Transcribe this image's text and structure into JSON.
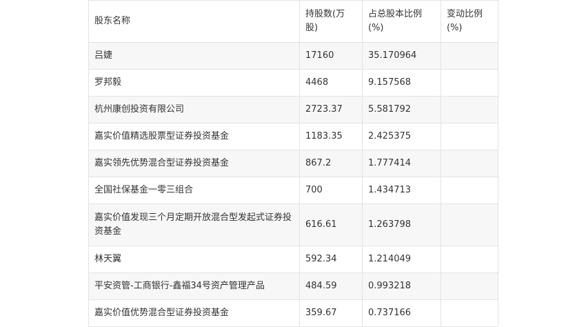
{
  "table": {
    "headers": [
      "股东名称",
      "持股数(万股)",
      "占总股本比例(%)",
      "变动比例(%)"
    ],
    "rows": [
      {
        "name": "吕婕",
        "shares": "17160",
        "ratio": "35.170964",
        "change": ""
      },
      {
        "name": "罗邦毅",
        "shares": "4468",
        "ratio": "9.157568",
        "change": ""
      },
      {
        "name": "杭州康创投资有限公司",
        "shares": "2723.37",
        "ratio": "5.581792",
        "change": ""
      },
      {
        "name": "嘉实价值精选股票型证券投资基金",
        "shares": "1183.35",
        "ratio": "2.425375",
        "change": ""
      },
      {
        "name": "嘉实领先优势混合型证券投资基金",
        "shares": "867.2",
        "ratio": "1.777414",
        "change": ""
      },
      {
        "name": "全国社保基金一零三组合",
        "shares": "700",
        "ratio": "1.434713",
        "change": ""
      },
      {
        "name": "嘉实价值发现三个月定期开放混合型发起式证券投资基金",
        "shares": "616.61",
        "ratio": "1.263798",
        "change": ""
      },
      {
        "name": "林天翼",
        "shares": "592.34",
        "ratio": "1.214049",
        "change": ""
      },
      {
        "name": "平安资管-工商银行-鑫福34号资产管理产品",
        "shares": "484.59",
        "ratio": "0.993218",
        "change": ""
      },
      {
        "name": "嘉实价值优势混合型证券投资基金",
        "shares": "359.67",
        "ratio": "0.737166",
        "change": ""
      }
    ]
  }
}
